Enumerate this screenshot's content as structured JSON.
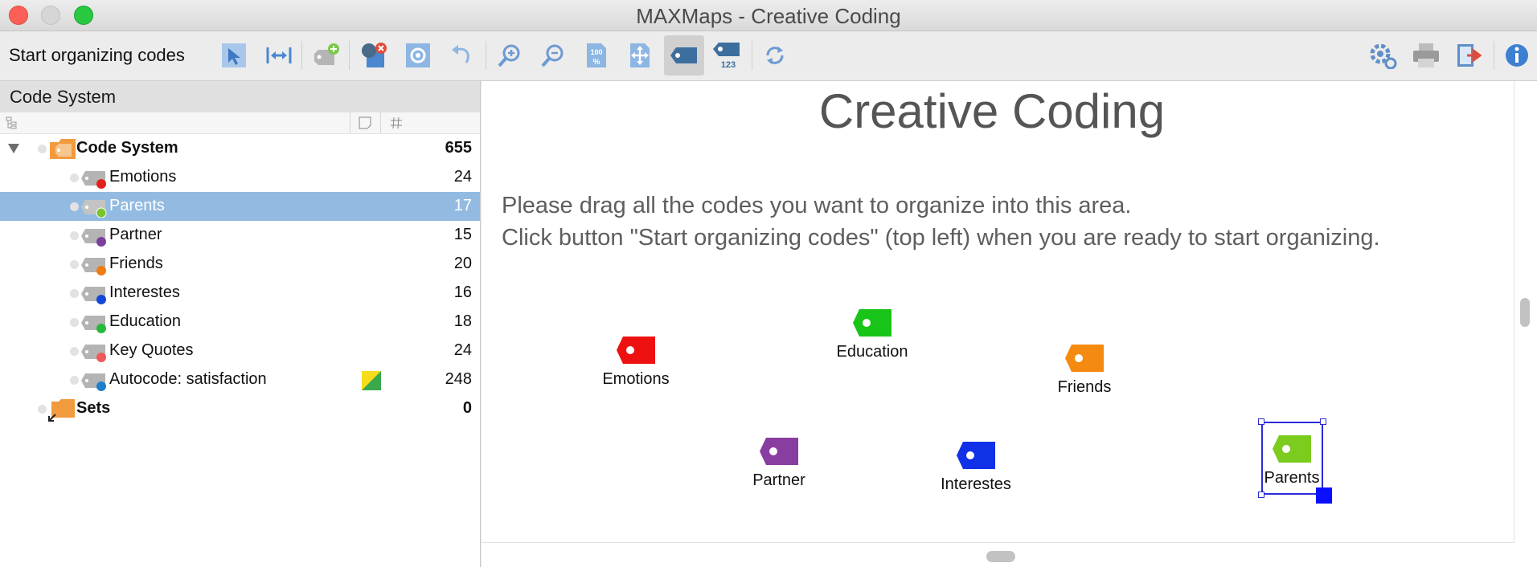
{
  "window": {
    "title": "MAXMaps - Creative Coding"
  },
  "toolbar": {
    "start_label": "Start organizing codes",
    "icons": [
      "select-pointer-icon",
      "distribute-horizontal-icon",
      "add-code-icon",
      "remove-code-icon",
      "settings-gear-icon",
      "undo-icon",
      "zoom-in-icon",
      "zoom-out-icon",
      "zoom-100-icon",
      "fit-page-icon",
      "show-code-icon",
      "code-frequency-icon",
      "refresh-icon",
      "preferences-icon",
      "print-icon",
      "export-icon",
      "info-icon"
    ]
  },
  "code_system": {
    "title": "Code System",
    "root": {
      "label": "Code System",
      "count": "655"
    },
    "items": [
      {
        "label": "Emotions",
        "count": "24",
        "color": "#e52019"
      },
      {
        "label": "Parents",
        "count": "17",
        "color": "#7ac42e"
      },
      {
        "label": "Partner",
        "count": "15",
        "color": "#7b3f9e"
      },
      {
        "label": "Friends",
        "count": "20",
        "color": "#f07c12"
      },
      {
        "label": "Interestes",
        "count": "16",
        "color": "#1447d9"
      },
      {
        "label": "Education",
        "count": "18",
        "color": "#27b93b"
      },
      {
        "label": "Key Quotes",
        "count": "24",
        "color": "#f0585a"
      },
      {
        "label": "Autocode: satisfaction",
        "count": "248",
        "color": "#1d7ecb"
      }
    ],
    "sets": {
      "label": "Sets",
      "count": "0"
    }
  },
  "map": {
    "title": "Creative Coding",
    "instruction_1": "Please drag all the codes you want to organize into this area.",
    "instruction_2": "Click button \"Start organizing codes\" (top left) when you are ready to start organizing.",
    "nodes": [
      {
        "label": "Emotions",
        "color": "#ee1111"
      },
      {
        "label": "Education",
        "color": "#17c417"
      },
      {
        "label": "Friends",
        "color": "#f58a10"
      },
      {
        "label": "Partner",
        "color": "#8a3da0"
      },
      {
        "label": "Interestes",
        "color": "#1131e8"
      },
      {
        "label": "Parents",
        "color": "#7bcc1e"
      }
    ]
  }
}
